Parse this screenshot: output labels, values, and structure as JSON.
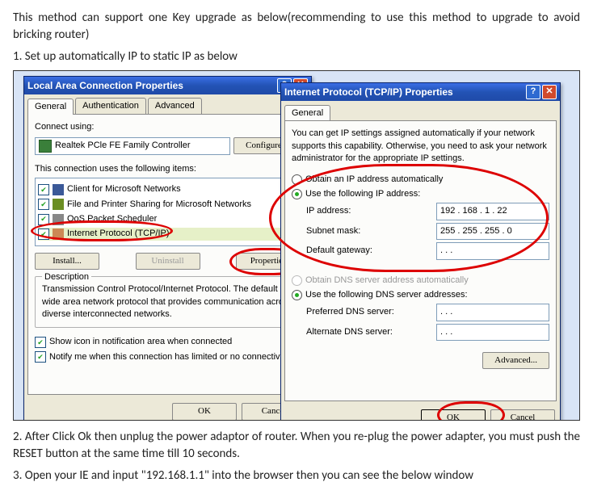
{
  "intro": "This method can support one Key upgrade as below(recommending to use this method to upgrade to avoid bricking router)",
  "step1": "1.  Set up automatically IP to static IP as below",
  "step2": "2. After Click Ok    then unplug the power adaptor of router. When you re-plug the power adapter, you must push the RESET button at the same time till 10 seconds.",
  "step3": "3. Open your IE and input \"192.168.1.1\" into the browser    then you can see the below window",
  "dlg1": {
    "title": "Local Area Connection Properties",
    "tabs": [
      "General",
      "Authentication",
      "Advanced"
    ],
    "connect_label": "Connect using:",
    "adapter": "Realtek PCle FE Family Controller",
    "configure_btn": "Configure...",
    "uses_label": "This connection uses the following items:",
    "items": [
      {
        "label": "Client for Microsoft Networks",
        "checked": true
      },
      {
        "label": "File and Printer Sharing for Microsoft Networks",
        "checked": true
      },
      {
        "label": "QoS Packet Scheduler",
        "checked": true
      },
      {
        "label": "Internet Protocol (TCP/IP)",
        "checked": true,
        "highlight": true
      }
    ],
    "install_btn": "Install...",
    "uninstall_btn": "Uninstall",
    "properties_btn": "Properties",
    "desc_title": "Description",
    "desc_text": "Transmission Control Protocol/Internet Protocol. The default wide area network protocol that provides communication across diverse interconnected networks.",
    "show_icon": "Show icon in notification area when connected",
    "notify": "Notify me when this connection has limited or no connectivity",
    "ok": "OK",
    "cancel": "Cancel"
  },
  "dlg2": {
    "title": "Internet Protocol (TCP/IP) Properties",
    "tab": "General",
    "blurb": "You can get IP settings assigned automatically if your network supports this capability. Otherwise, you need to ask your network administrator for the appropriate IP settings.",
    "opt_auto_ip": "Obtain an IP address automatically",
    "opt_use_ip": "Use the following IP address:",
    "ip_label": "IP address:",
    "ip_value": "192 . 168 .  1  . 22",
    "mask_label": "Subnet mask:",
    "mask_value": "255 . 255 . 255 .  0",
    "gw_label": "Default gateway:",
    "gw_value": " .      .      .   ",
    "opt_auto_dns": "Obtain DNS server address automatically",
    "opt_use_dns": "Use the following DNS server addresses:",
    "pref_dns": "Preferred DNS server:",
    "alt_dns": "Alternate DNS server:",
    "dns_value": " .      .      .   ",
    "advanced": "Advanced...",
    "ok": "OK",
    "cancel": "Cancel"
  }
}
